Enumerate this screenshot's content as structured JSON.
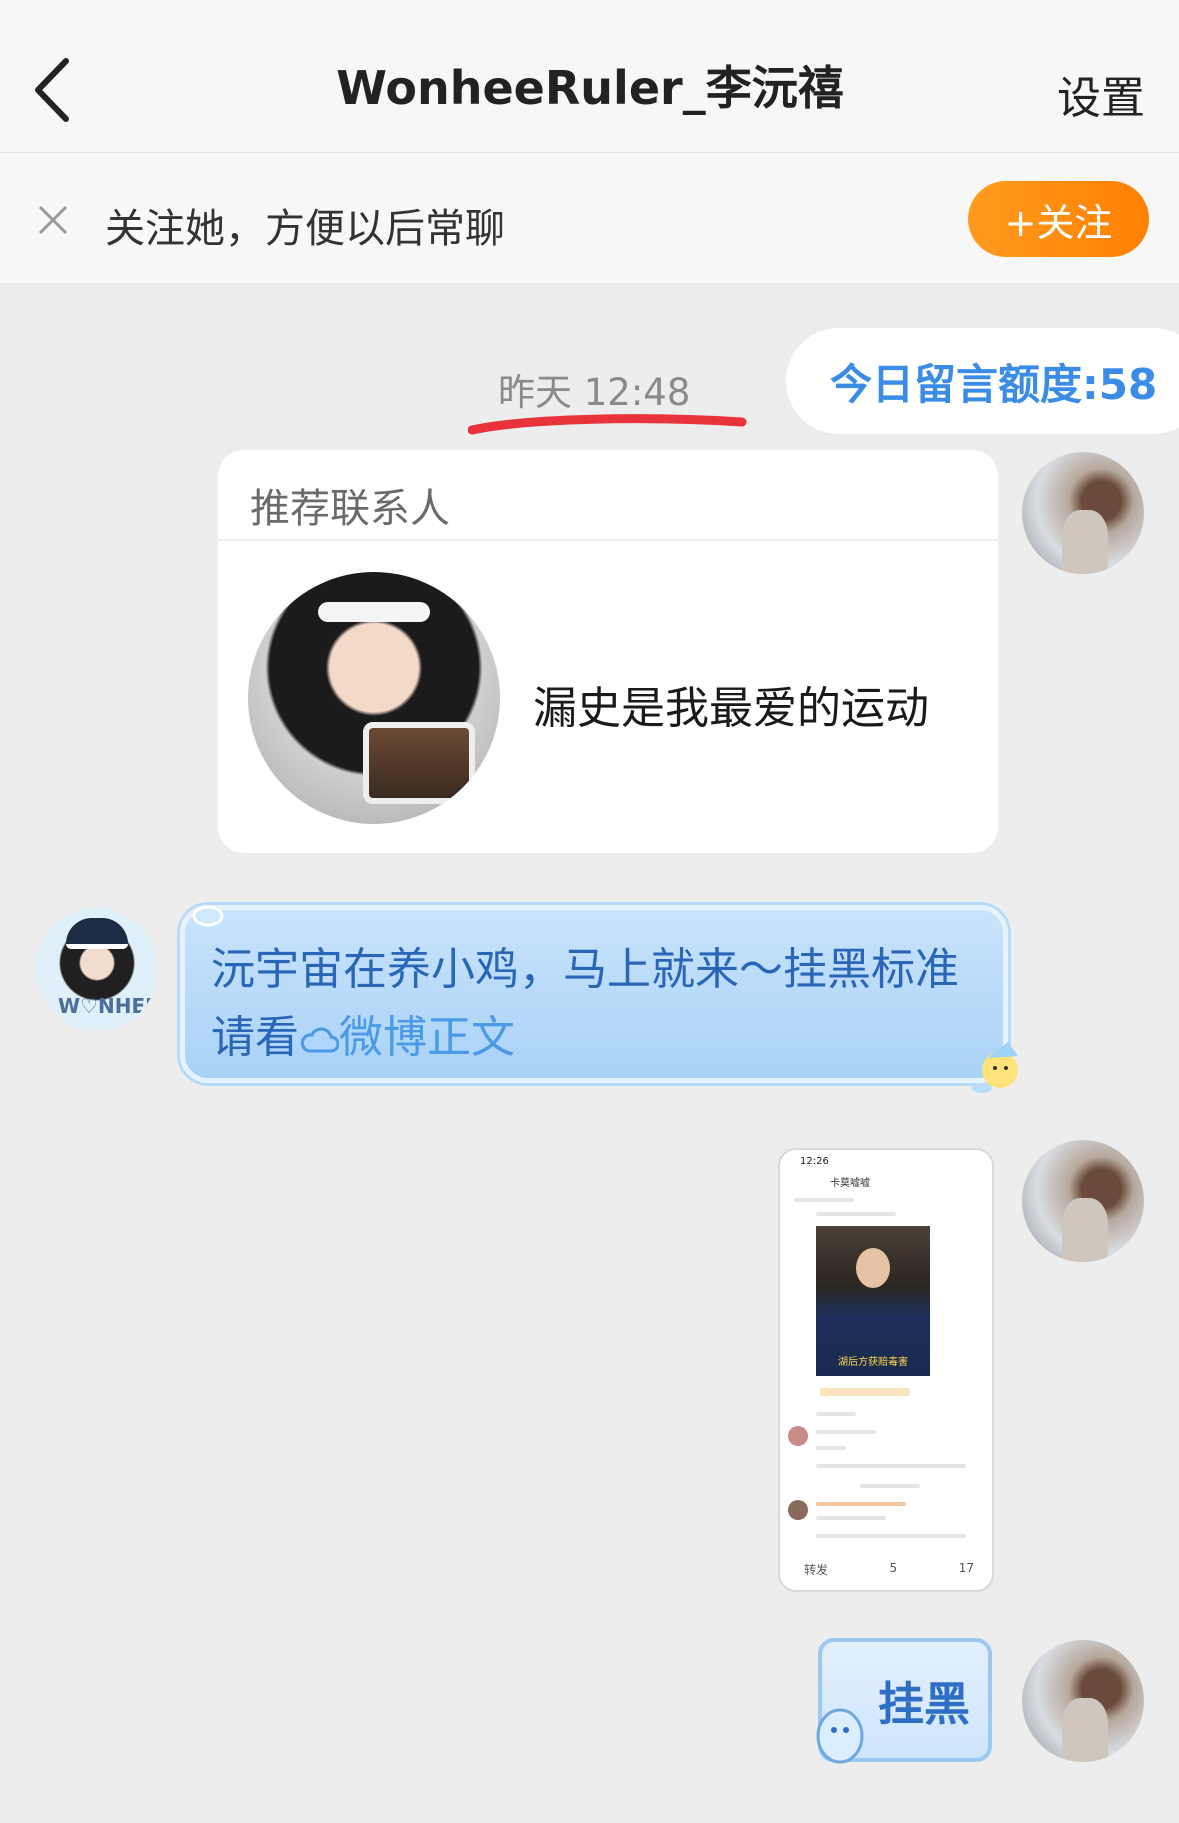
{
  "header": {
    "back_icon": "chevron-left-icon",
    "title": "WonheeRuler_李沅禧",
    "settings_label": "设置"
  },
  "follow_bar": {
    "close_icon": "close-icon",
    "text": "关注她，方便以后常聊",
    "button_label": "+关注",
    "button_color": "#ff8c0f"
  },
  "chat": {
    "timestamp": "昨天 12:48",
    "quota": "今日留言额度:58",
    "card": {
      "title": "推荐联系人",
      "text": "漏史是我最爱的运动"
    },
    "message": {
      "text": "沅宇宙在养小鸡，马上就来～挂黑标准请看",
      "link_icon": "cloud-icon",
      "link_text": "微博正文"
    },
    "screenshot": {
      "status_time": "12:26",
      "name": "卡莫嘘嘘",
      "photo_caption": "湖后方获赔毒害",
      "actions": [
        "转发",
        "5",
        "17"
      ]
    },
    "sticker_label": "挂黑"
  },
  "colors": {
    "accent_orange": "#ff8c0f",
    "link_blue": "#3b8ce6",
    "underline_red": "#e8323c"
  }
}
